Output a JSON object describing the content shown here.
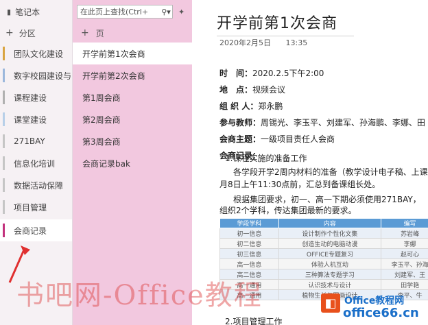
{
  "notebook": {
    "label": "笔记本"
  },
  "sections": {
    "add_label": "分区",
    "items": [
      {
        "label": "团队文化建设",
        "color": "#d9a441"
      },
      {
        "label": "数字校园建设与",
        "color": "#9bb7dc"
      },
      {
        "label": "课程建设",
        "color": "#b0b0b0"
      },
      {
        "label": "课堂建设",
        "color": "#b7cfe8"
      },
      {
        "label": "271BAY",
        "color": "#c5c5c5"
      },
      {
        "label": "信息化培训",
        "color": "#c5c5c5"
      },
      {
        "label": "数据活动保障",
        "color": "#c5c5c5"
      },
      {
        "label": "项目管理",
        "color": "#c5c5c5"
      },
      {
        "label": "会商记录",
        "color": "#c2307c"
      }
    ]
  },
  "pages": {
    "search_placeholder": "在此页上查找(Ctrl+",
    "add_label": "页",
    "items": [
      {
        "label": "开学前第1次会商",
        "selected": true
      },
      {
        "label": "开学前第2次会商",
        "selected": false
      },
      {
        "label": "第1周会商",
        "selected": false
      },
      {
        "label": "第2周会商",
        "selected": false
      },
      {
        "label": "第3周会商",
        "selected": false
      },
      {
        "label": "会商记录bak",
        "selected": false
      }
    ]
  },
  "content": {
    "title": "开学前第1次会商",
    "date": "2020年2月5日",
    "time": "13:35",
    "meta": [
      {
        "label": "时　间：",
        "value": "2020.2.5下午2:00"
      },
      {
        "label": "地　点：",
        "value": "视频会议"
      },
      {
        "label": "组 织 人：",
        "value": "郑永鹏"
      },
      {
        "label": "参与教师：",
        "value": "周锡光、李玉平、刘建军、孙海鹏、李娜、田"
      },
      {
        "label": "会商主题：",
        "value": "一级项目责任人会商"
      },
      {
        "label": "会商记录：",
        "value": ""
      }
    ],
    "lines": [
      "1.课程实施的准备工作",
      "各学段开学2周内材料的准备（教学设计电子稿、上课",
      "月8日上午11:30点前，汇总到备课组长处。",
      "根据集团要求，初一、高一下期必须使用271BAY，",
      "组织2个学科，传达集团最新的要求。",
      "2.项目管理工作"
    ],
    "table": {
      "headers": [
        "学段学科",
        "内容",
        "编写"
      ],
      "rows": [
        [
          "初一信息",
          "设计制作个性化文集",
          "苏岩峰"
        ],
        [
          "初二信息",
          "创造生动的电脑动漫",
          "李娜"
        ],
        [
          "初三信息",
          "OFFICE专题复习",
          "赵可心"
        ],
        [
          "高一信息",
          "体验人机互动",
          "李玉平、孙海"
        ],
        [
          "高二信息",
          "三种算法专题学习",
          "刘建军、王"
        ],
        [
          "高一通用",
          "认识技术与设计",
          "田学艳"
        ],
        [
          "高一通用",
          "植物生长与图画设计",
          "李平、牛"
        ]
      ]
    }
  },
  "watermark": {
    "text": "书吧网-Office教程",
    "site1": "Office教程网",
    "site2": "office66.cn"
  }
}
